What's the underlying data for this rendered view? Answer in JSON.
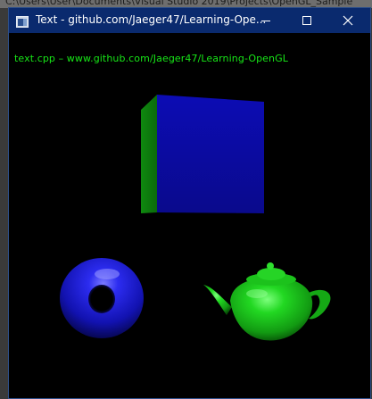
{
  "background_window": {
    "partial_title": "C:\\Users\\User\\Documents\\Visual Studio 2019\\Projects\\OpenGL_Sample"
  },
  "window": {
    "title": "Text - github.com/Jaeger47/Learning-Ope...",
    "controls": {
      "minimize": "minimize-icon",
      "maximize": "maximize-icon",
      "close": "close-icon"
    }
  },
  "canvas": {
    "overlay_text": "text.cpp  –  www.github.com/Jaeger47/Learning-OpenGL",
    "text_color": "#17e617",
    "background_color": "#000000"
  },
  "scene": {
    "objects": [
      {
        "name": "cube",
        "front_color": "#1010a0",
        "side_color": "#0f7a0f"
      },
      {
        "name": "torus",
        "color": "#1a1ad0"
      },
      {
        "name": "teapot",
        "color": "#16b016"
      }
    ]
  },
  "colors": {
    "titlebar": "#0a2a6e",
    "border": "#2d4f8a"
  }
}
